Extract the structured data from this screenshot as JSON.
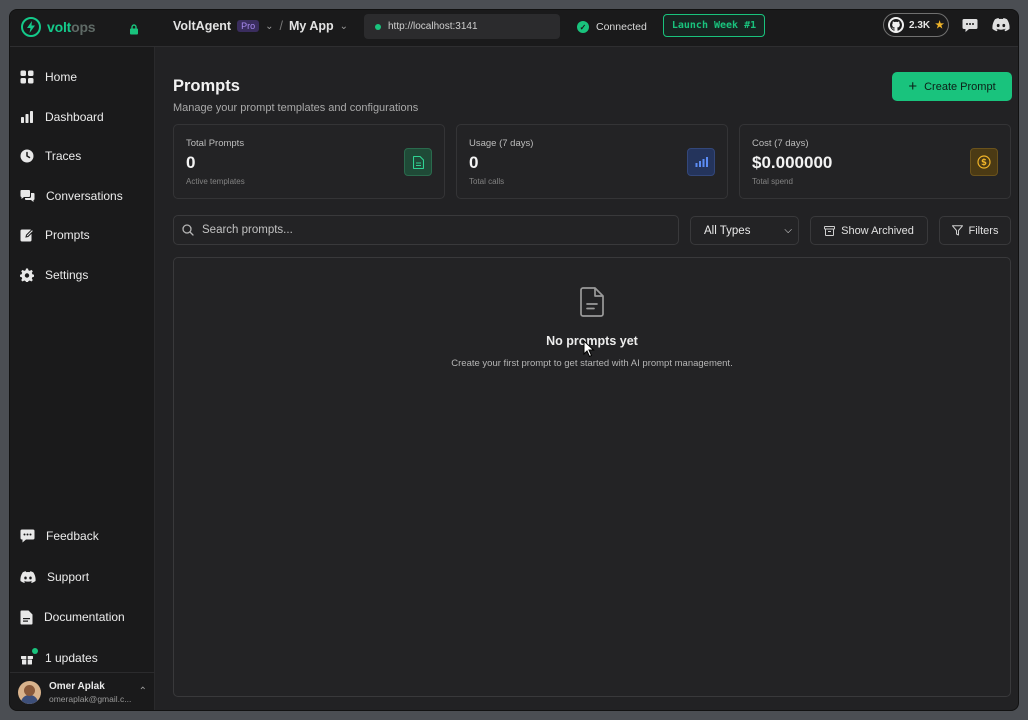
{
  "brand": {
    "name_main": "volt",
    "name_suffix": "ops"
  },
  "header": {
    "org_name": "VoltAgent",
    "org_badge": "Pro",
    "separator": "/",
    "app_name": "My App",
    "url": "http://localhost:3141",
    "connection_status": "Connected",
    "launch_label": "Launch Week #1",
    "github_stars": "2.3K"
  },
  "sidebar": {
    "items": [
      {
        "label": "Home",
        "icon": "grid-icon"
      },
      {
        "label": "Dashboard",
        "icon": "bar-chart-icon"
      },
      {
        "label": "Traces",
        "icon": "clock-icon"
      },
      {
        "label": "Conversations",
        "icon": "chat-bubbles-icon"
      },
      {
        "label": "Prompts",
        "icon": "edit-icon"
      },
      {
        "label": "Settings",
        "icon": "gear-icon"
      }
    ],
    "bottom_items": [
      {
        "label": "Feedback",
        "icon": "message-icon"
      },
      {
        "label": "Support",
        "icon": "discord-icon"
      },
      {
        "label": "Documentation",
        "icon": "document-icon"
      },
      {
        "label": "1 updates",
        "icon": "gift-icon"
      }
    ],
    "user": {
      "name": "Omer Aplak",
      "email": "omeraplak@gmail.c..."
    }
  },
  "main": {
    "title": "Prompts",
    "subtitle": "Manage your prompt templates and configurations",
    "create_button": "Create Prompt",
    "cards": [
      {
        "label": "Total Prompts",
        "value": "0",
        "sub": "Active templates",
        "icon": "file-icon",
        "color": "#19c37d"
      },
      {
        "label": "Usage (7 days)",
        "value": "0",
        "sub": "Total calls",
        "icon": "bar-chart-icon",
        "color": "#4f7ff0"
      },
      {
        "label": "Cost (7 days)",
        "value": "$0.000000",
        "sub": "Total spend",
        "icon": "dollar-coin-icon",
        "color": "#e6a817"
      }
    ],
    "search_placeholder": "Search prompts...",
    "type_select": "All Types",
    "show_archived": "Show Archived",
    "filters": "Filters",
    "empty_title": "No prompts yet",
    "empty_subtitle": "Create your first prompt to get started with AI prompt management."
  },
  "colors": {
    "accent": "#19c37d",
    "background": "#222224",
    "sidebar": "#1a1a1b"
  }
}
